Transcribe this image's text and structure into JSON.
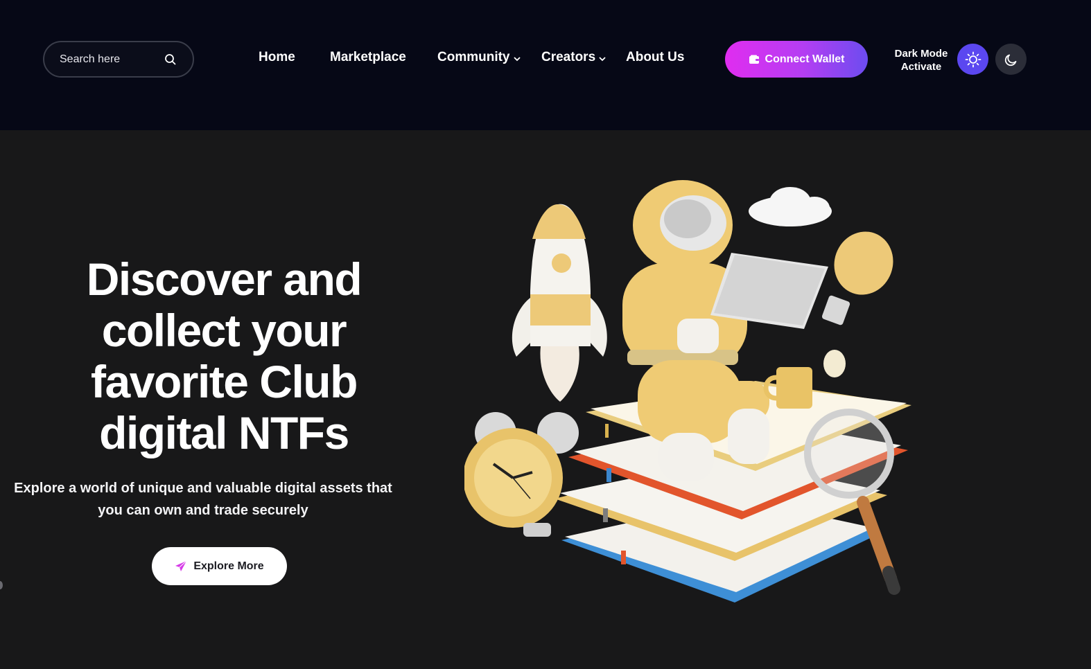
{
  "search": {
    "placeholder": "Search here"
  },
  "nav": {
    "items": [
      {
        "label": "Home",
        "dropdown": false
      },
      {
        "label": "Marketplace",
        "dropdown": false
      },
      {
        "label": "Community",
        "dropdown": true
      },
      {
        "label": "Creators",
        "dropdown": true
      },
      {
        "label": "About Us",
        "dropdown": false
      }
    ]
  },
  "header": {
    "connect_label": "Connect Wallet",
    "dark_mode_line1": "Dark Mode",
    "dark_mode_line2": "Activate"
  },
  "hero": {
    "title_line1": "Discover and",
    "title_line2": "collect your",
    "title_line3": "favorite Club",
    "title_line4": "digital NTFs",
    "subtitle_line1": "Explore a world of unique and valuable digital assets that",
    "subtitle_line2": "you can own and trade securely",
    "cta_label": "Explore More"
  },
  "colors": {
    "header_bg": "#060816",
    "page_bg": "#181819",
    "accent_gradient_start": "#e02df0",
    "accent_gradient_end": "#6c4cf0",
    "sun_button": "#5b47f0",
    "moon_button": "#2b2d38"
  },
  "icons": {
    "search": "search-icon",
    "wallet": "wallet-icon",
    "sun": "sun-icon",
    "moon": "moon-icon",
    "send": "paper-plane-icon",
    "chevron": "chevron-down-icon"
  }
}
